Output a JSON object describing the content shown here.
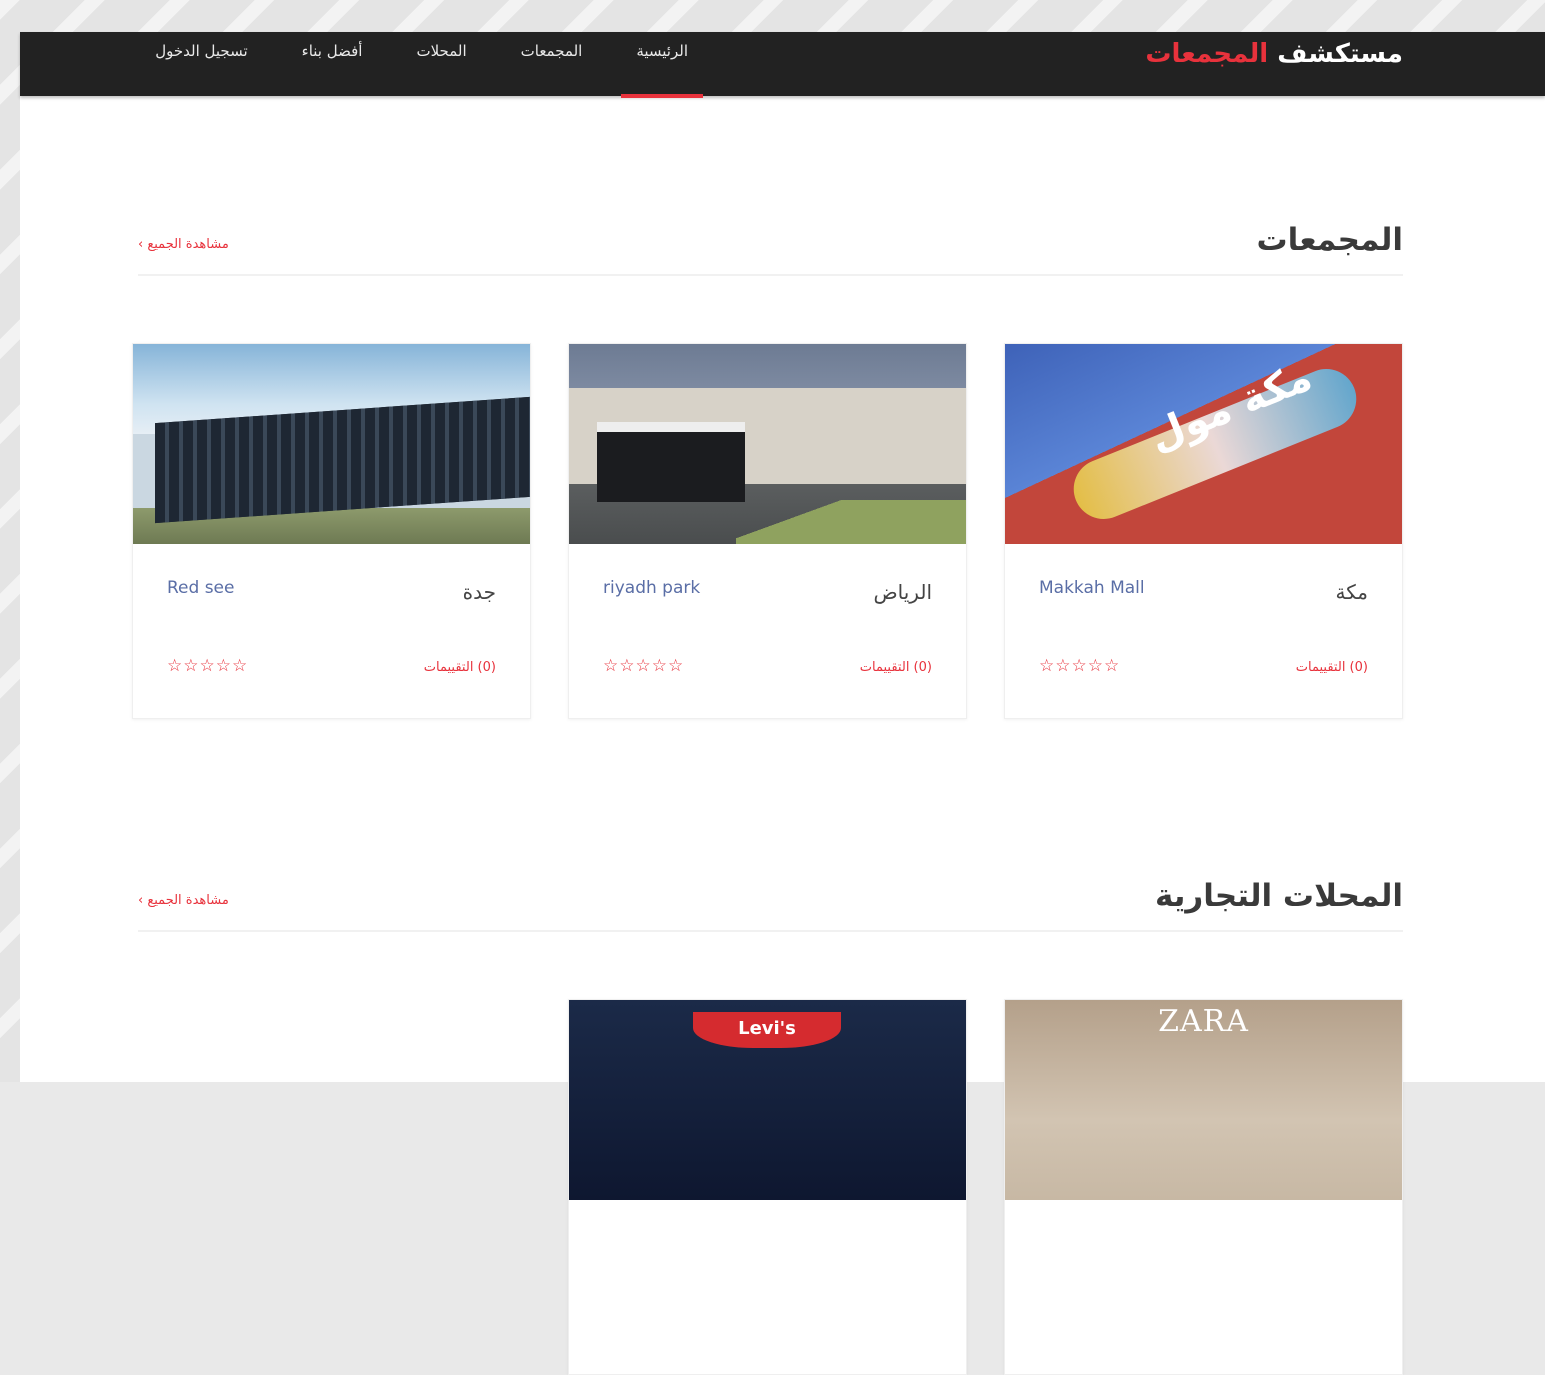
{
  "brand": {
    "part1": "مستكشف",
    "part2": "المجمعات"
  },
  "nav": {
    "items": [
      {
        "label": "الرئيسية",
        "active": true
      },
      {
        "label": "المجمعات",
        "active": false
      },
      {
        "label": "المحلات",
        "active": false
      },
      {
        "label": "أفضل بناء",
        "active": false
      },
      {
        "label": "تسجيل الدخول",
        "active": false
      }
    ]
  },
  "malls_section": {
    "title": "المجمعات",
    "view_all": "مشاهدة الجميع ›",
    "cards": [
      {
        "city": "مكة",
        "name": "Makkah Mall",
        "stars": "☆☆☆☆☆",
        "reviews": "(0) التقييمات",
        "image_text": "مكة مول"
      },
      {
        "city": "الرياض",
        "name": "riyadh park",
        "stars": "☆☆☆☆☆",
        "reviews": "(0) التقييمات"
      },
      {
        "city": "جدة",
        "name": "Red see",
        "stars": "☆☆☆☆☆",
        "reviews": "(0) التقييمات"
      }
    ]
  },
  "shops_section": {
    "title": "المحلات التجارية",
    "view_all": "مشاهدة الجميع ›",
    "cards": [
      {
        "logo": "ZARA"
      },
      {
        "logo": "Levi's"
      }
    ]
  },
  "colors": {
    "accent": "#e8323c",
    "navbar": "#222222"
  }
}
